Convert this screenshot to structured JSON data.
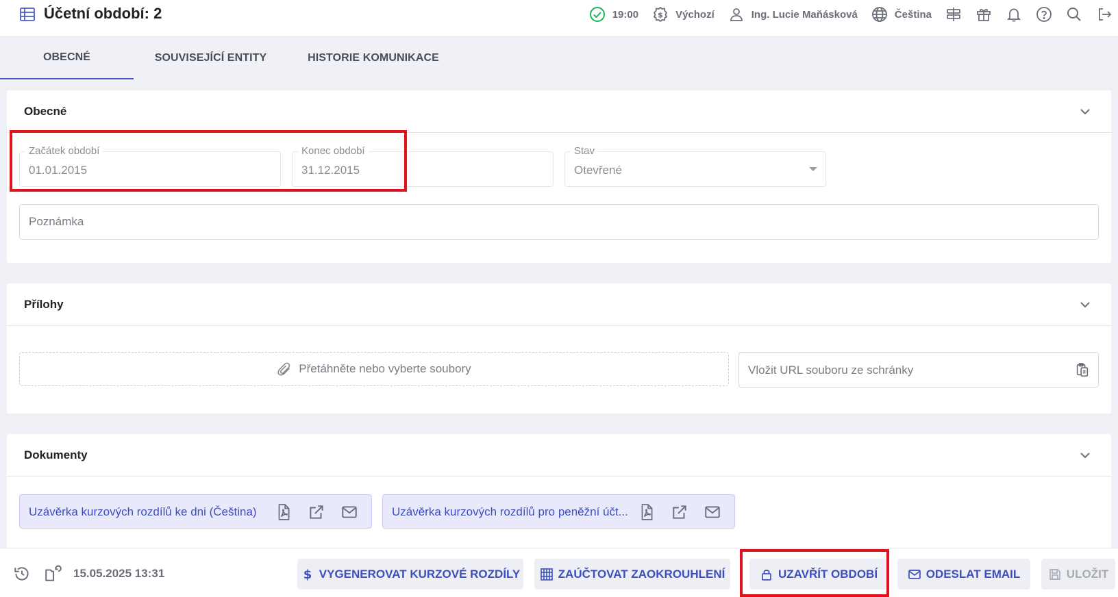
{
  "header": {
    "title": "Účetní období: 2",
    "time": "19:00",
    "company": "Výchozí",
    "user": "Ing. Lucie Maňásková",
    "language": "Čeština"
  },
  "tabs": [
    {
      "label": "OBECNÉ",
      "active": true
    },
    {
      "label": "SOUVISEJÍCÍ ENTITY",
      "active": false
    },
    {
      "label": "HISTORIE KOMUNIKACE",
      "active": false
    }
  ],
  "general": {
    "title": "Obecné",
    "start_label": "Začátek období",
    "start_value": "01.01.2015",
    "end_label": "Konec období",
    "end_value": "31.12.2015",
    "status_label": "Stav",
    "status_value": "Otevřené",
    "note_placeholder": "Poznámka"
  },
  "attachments": {
    "title": "Přílohy",
    "drop_text": "Přetáhněte nebo vyberte soubory",
    "url_placeholder": "Vložit URL souboru ze schránky"
  },
  "documents": {
    "title": "Dokumenty",
    "items": [
      {
        "name": "Uzávěrka kurzových rozdílů ke dni (Čeština)"
      },
      {
        "name": "Uzávěrka kurzových rozdílů pro peněžní účt..."
      }
    ]
  },
  "footer": {
    "timestamp": "15.05.2025 13:31",
    "generate_label": "VYGENEROVAT KURZOVÉ ROZDÍLY",
    "rounding_label": "ZAÚČTOVAT ZAOKROUHLENÍ",
    "close_label": "UZAVŘÍT OBDOBÍ",
    "email_label": "ODESLAT EMAIL",
    "save_label": "ULOŽIT"
  },
  "colors": {
    "accent": "#3d4fbf",
    "highlight": "#e0121d",
    "success": "#1bb55c",
    "background": "#f0f1f6"
  },
  "icons": [
    "table-icon",
    "check-circle-icon",
    "dollar-circle-icon",
    "user-icon",
    "globe-icon",
    "signpost-icon",
    "gift-icon",
    "bell-icon",
    "help-icon",
    "search-icon",
    "logout-icon",
    "chevron-down-icon",
    "paperclip-icon",
    "clipboard-icon",
    "pdf-icon",
    "external-link-icon",
    "mail-icon",
    "history-icon",
    "restore-icon",
    "dollar-icon",
    "abacus-icon",
    "lock-icon",
    "save-icon"
  ]
}
